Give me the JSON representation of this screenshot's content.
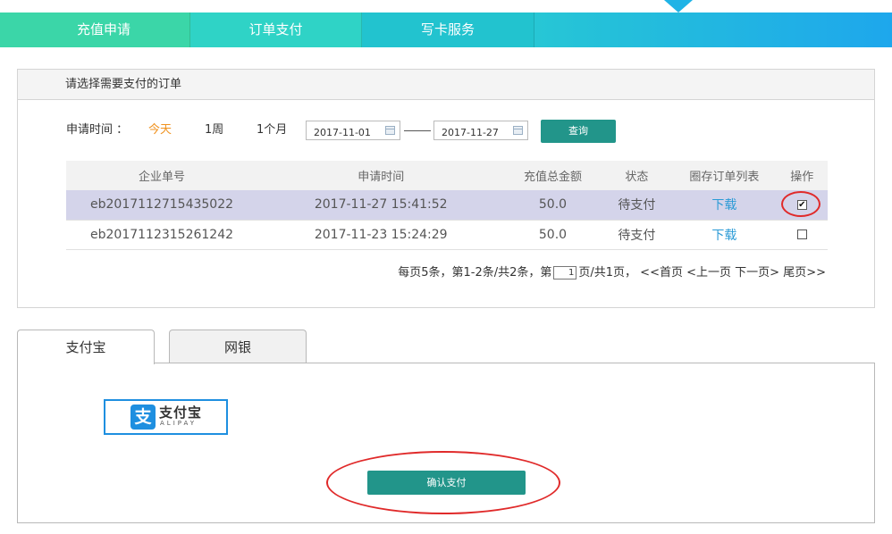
{
  "nav": {
    "tabs": [
      "充值申请",
      "订单支付",
      "写卡服务"
    ]
  },
  "panel": {
    "title": "请选择需要支付的订单"
  },
  "filter": {
    "label": "申请时间 ：",
    "quick": [
      "今天",
      "1周",
      "1个月"
    ],
    "start_date": "2017-11-01",
    "end_date": "2017-11-27",
    "query_button": "查询"
  },
  "table": {
    "headers": [
      "企业单号",
      "申请时间",
      "充值总金额",
      "状态",
      "圈存订单列表",
      "操作"
    ],
    "rows": [
      {
        "order_no": "eb2017112715435022",
        "time": "2017-11-27 15:41:52",
        "amount": "50.0",
        "status": "待支付",
        "download": "下载",
        "checked": true
      },
      {
        "order_no": "eb2017112315261242",
        "time": "2017-11-23 15:24:29",
        "amount": "50.0",
        "status": "待支付",
        "download": "下载",
        "checked": false
      }
    ]
  },
  "pager": {
    "summary": "每页5条，第1-2条/共2条，第",
    "page_input": "1",
    "page_suffix": "页/共1页，",
    "first": "<<首页",
    "prev": "<上一页",
    "next": "下一页>",
    "last": "尾页>>"
  },
  "payment": {
    "tabs": [
      "支付宝",
      "网银"
    ],
    "alipay_logo_cn": "支付宝",
    "alipay_logo_en": "ALIPAY",
    "alipay_logo_glyph": "支",
    "confirm_button": "确认支付"
  },
  "colors": {
    "accent": "#22958a",
    "today_highlight": "#f0921e",
    "link": "#2a9ad6",
    "selected_row": "#d4d4ea",
    "annotation_ring": "#e02a2a"
  }
}
